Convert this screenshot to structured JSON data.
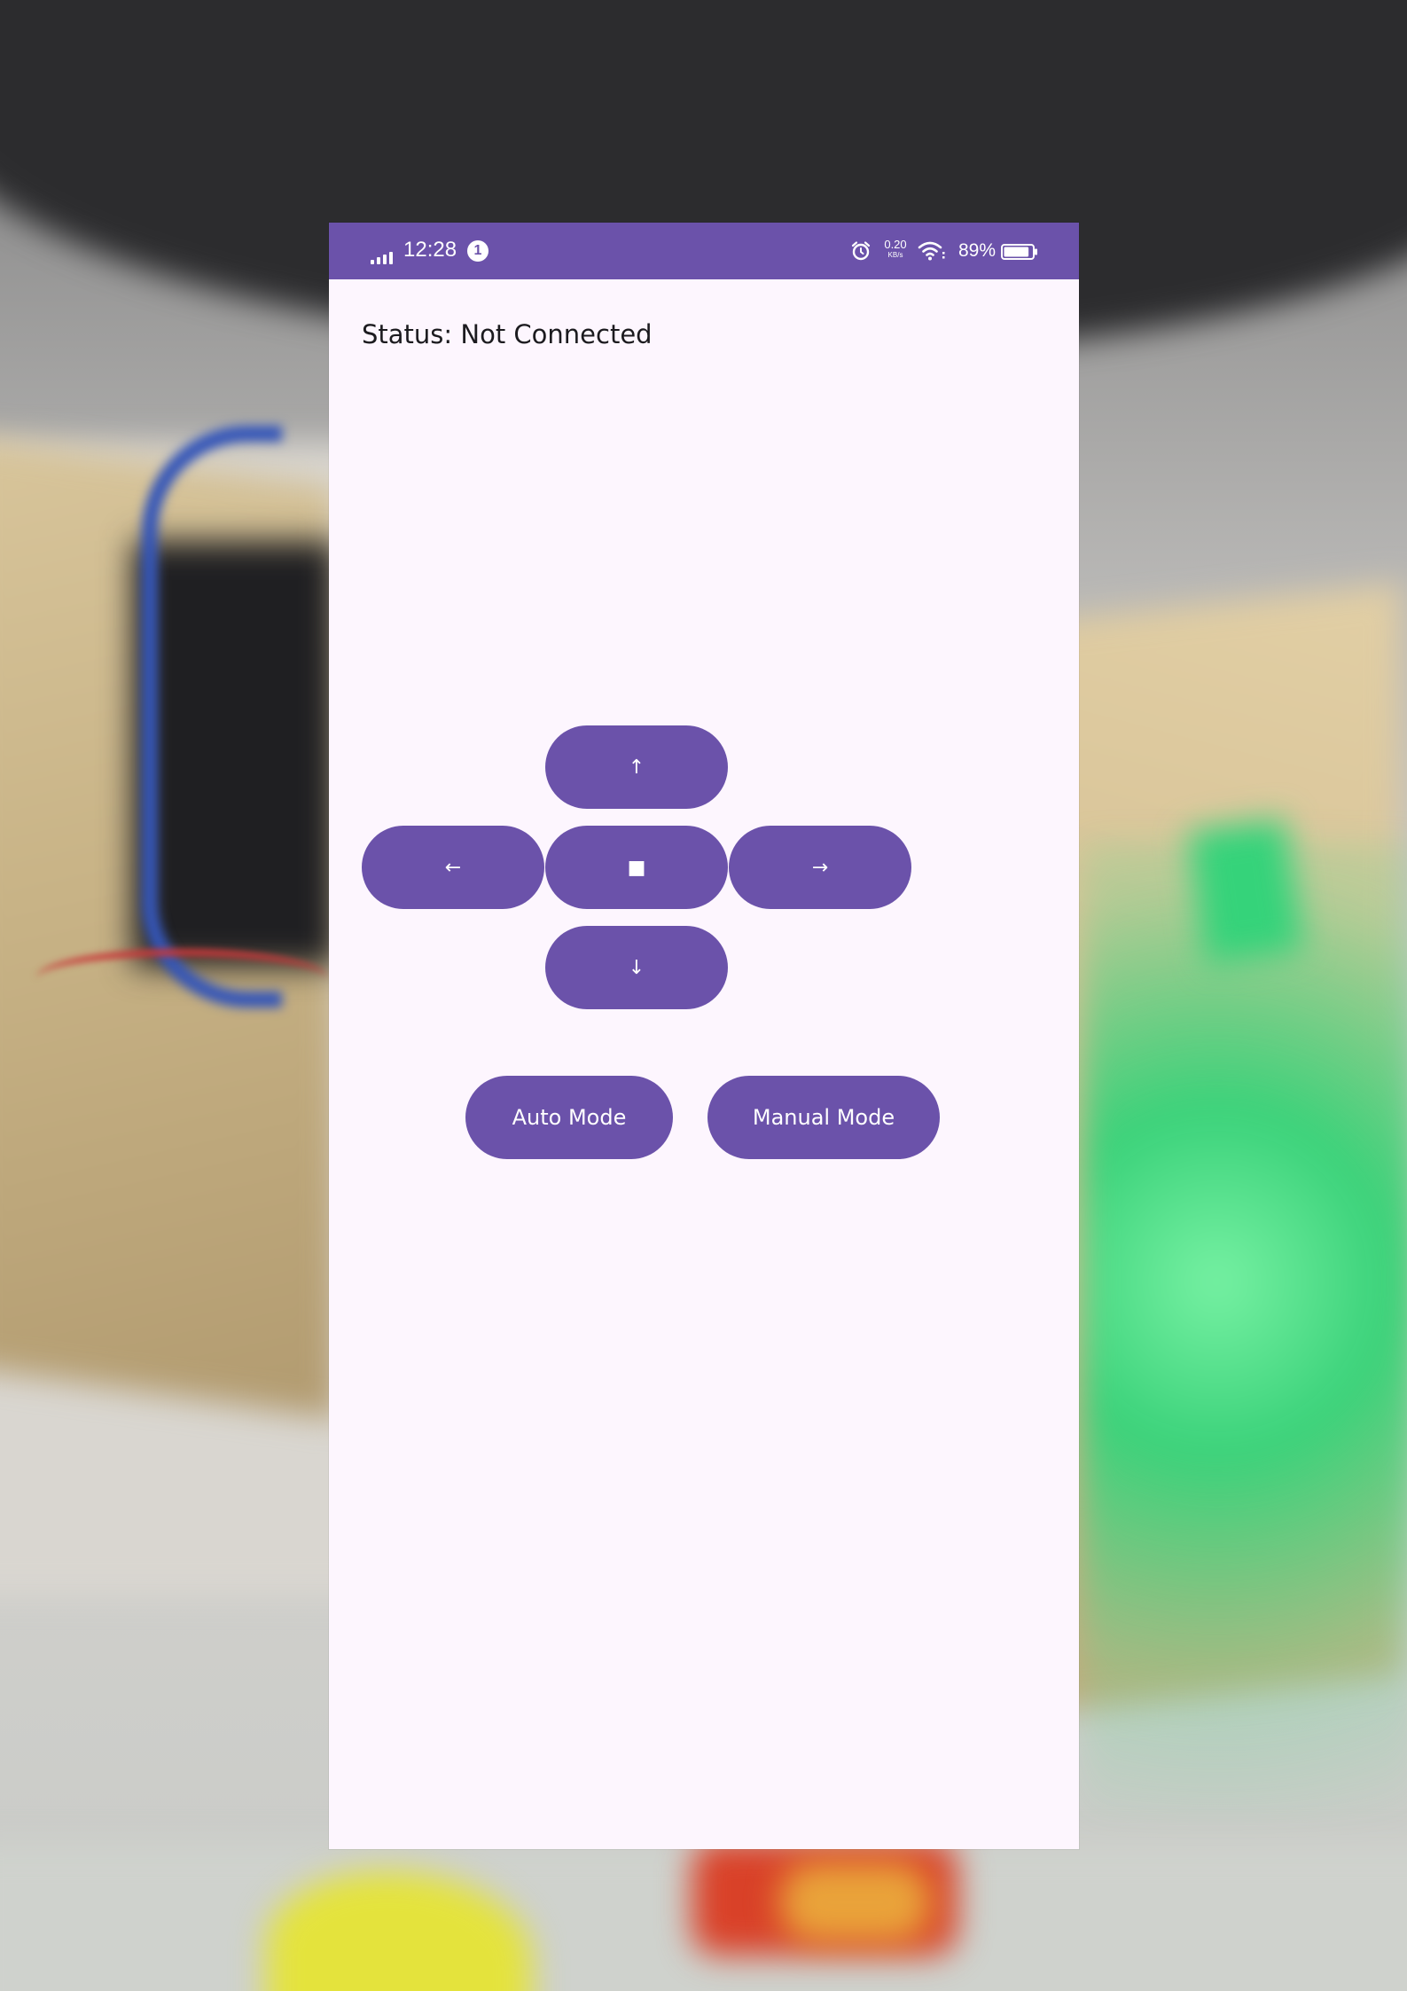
{
  "status_bar": {
    "time": "12:28",
    "notification_count": "1",
    "net_speed_value": "0.20",
    "net_speed_unit": "KB/s",
    "battery_percent": "89%",
    "background_color": "#6b52aa"
  },
  "main": {
    "status_text": "Status: Not Connected",
    "background_color": "#fdf6fe"
  },
  "controls": {
    "up_label": "↑",
    "left_label": "←",
    "stop_label": "■",
    "right_label": "→",
    "down_label": "↓",
    "button_color": "#6b52aa"
  },
  "modes": {
    "auto_label": "Auto Mode",
    "manual_label": "Manual Mode"
  },
  "icons": {
    "signal": "signal-icon",
    "notification": "notification-badge-icon",
    "alarm": "alarm-icon",
    "wifi": "wifi-icon",
    "battery": "battery-icon",
    "battery_level": 0.89
  }
}
